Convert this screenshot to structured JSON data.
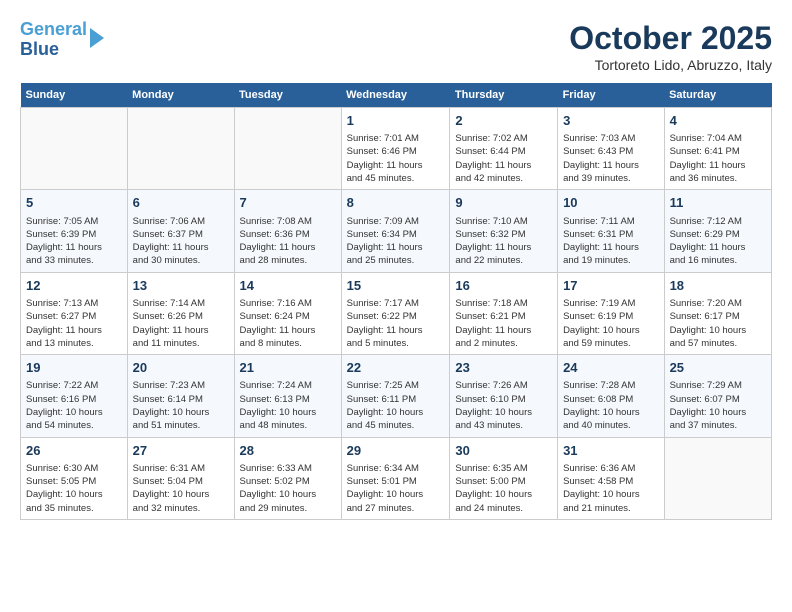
{
  "header": {
    "logo_line1": "General",
    "logo_line2": "Blue",
    "month": "October 2025",
    "location": "Tortoreto Lido, Abruzzo, Italy"
  },
  "weekdays": [
    "Sunday",
    "Monday",
    "Tuesday",
    "Wednesday",
    "Thursday",
    "Friday",
    "Saturday"
  ],
  "weeks": [
    [
      {
        "day": "",
        "info": ""
      },
      {
        "day": "",
        "info": ""
      },
      {
        "day": "",
        "info": ""
      },
      {
        "day": "1",
        "info": "Sunrise: 7:01 AM\nSunset: 6:46 PM\nDaylight: 11 hours\nand 45 minutes."
      },
      {
        "day": "2",
        "info": "Sunrise: 7:02 AM\nSunset: 6:44 PM\nDaylight: 11 hours\nand 42 minutes."
      },
      {
        "day": "3",
        "info": "Sunrise: 7:03 AM\nSunset: 6:43 PM\nDaylight: 11 hours\nand 39 minutes."
      },
      {
        "day": "4",
        "info": "Sunrise: 7:04 AM\nSunset: 6:41 PM\nDaylight: 11 hours\nand 36 minutes."
      }
    ],
    [
      {
        "day": "5",
        "info": "Sunrise: 7:05 AM\nSunset: 6:39 PM\nDaylight: 11 hours\nand 33 minutes."
      },
      {
        "day": "6",
        "info": "Sunrise: 7:06 AM\nSunset: 6:37 PM\nDaylight: 11 hours\nand 30 minutes."
      },
      {
        "day": "7",
        "info": "Sunrise: 7:08 AM\nSunset: 6:36 PM\nDaylight: 11 hours\nand 28 minutes."
      },
      {
        "day": "8",
        "info": "Sunrise: 7:09 AM\nSunset: 6:34 PM\nDaylight: 11 hours\nand 25 minutes."
      },
      {
        "day": "9",
        "info": "Sunrise: 7:10 AM\nSunset: 6:32 PM\nDaylight: 11 hours\nand 22 minutes."
      },
      {
        "day": "10",
        "info": "Sunrise: 7:11 AM\nSunset: 6:31 PM\nDaylight: 11 hours\nand 19 minutes."
      },
      {
        "day": "11",
        "info": "Sunrise: 7:12 AM\nSunset: 6:29 PM\nDaylight: 11 hours\nand 16 minutes."
      }
    ],
    [
      {
        "day": "12",
        "info": "Sunrise: 7:13 AM\nSunset: 6:27 PM\nDaylight: 11 hours\nand 13 minutes."
      },
      {
        "day": "13",
        "info": "Sunrise: 7:14 AM\nSunset: 6:26 PM\nDaylight: 11 hours\nand 11 minutes."
      },
      {
        "day": "14",
        "info": "Sunrise: 7:16 AM\nSunset: 6:24 PM\nDaylight: 11 hours\nand 8 minutes."
      },
      {
        "day": "15",
        "info": "Sunrise: 7:17 AM\nSunset: 6:22 PM\nDaylight: 11 hours\nand 5 minutes."
      },
      {
        "day": "16",
        "info": "Sunrise: 7:18 AM\nSunset: 6:21 PM\nDaylight: 11 hours\nand 2 minutes."
      },
      {
        "day": "17",
        "info": "Sunrise: 7:19 AM\nSunset: 6:19 PM\nDaylight: 10 hours\nand 59 minutes."
      },
      {
        "day": "18",
        "info": "Sunrise: 7:20 AM\nSunset: 6:17 PM\nDaylight: 10 hours\nand 57 minutes."
      }
    ],
    [
      {
        "day": "19",
        "info": "Sunrise: 7:22 AM\nSunset: 6:16 PM\nDaylight: 10 hours\nand 54 minutes."
      },
      {
        "day": "20",
        "info": "Sunrise: 7:23 AM\nSunset: 6:14 PM\nDaylight: 10 hours\nand 51 minutes."
      },
      {
        "day": "21",
        "info": "Sunrise: 7:24 AM\nSunset: 6:13 PM\nDaylight: 10 hours\nand 48 minutes."
      },
      {
        "day": "22",
        "info": "Sunrise: 7:25 AM\nSunset: 6:11 PM\nDaylight: 10 hours\nand 45 minutes."
      },
      {
        "day": "23",
        "info": "Sunrise: 7:26 AM\nSunset: 6:10 PM\nDaylight: 10 hours\nand 43 minutes."
      },
      {
        "day": "24",
        "info": "Sunrise: 7:28 AM\nSunset: 6:08 PM\nDaylight: 10 hours\nand 40 minutes."
      },
      {
        "day": "25",
        "info": "Sunrise: 7:29 AM\nSunset: 6:07 PM\nDaylight: 10 hours\nand 37 minutes."
      }
    ],
    [
      {
        "day": "26",
        "info": "Sunrise: 6:30 AM\nSunset: 5:05 PM\nDaylight: 10 hours\nand 35 minutes."
      },
      {
        "day": "27",
        "info": "Sunrise: 6:31 AM\nSunset: 5:04 PM\nDaylight: 10 hours\nand 32 minutes."
      },
      {
        "day": "28",
        "info": "Sunrise: 6:33 AM\nSunset: 5:02 PM\nDaylight: 10 hours\nand 29 minutes."
      },
      {
        "day": "29",
        "info": "Sunrise: 6:34 AM\nSunset: 5:01 PM\nDaylight: 10 hours\nand 27 minutes."
      },
      {
        "day": "30",
        "info": "Sunrise: 6:35 AM\nSunset: 5:00 PM\nDaylight: 10 hours\nand 24 minutes."
      },
      {
        "day": "31",
        "info": "Sunrise: 6:36 AM\nSunset: 4:58 PM\nDaylight: 10 hours\nand 21 minutes."
      },
      {
        "day": "",
        "info": ""
      }
    ]
  ]
}
